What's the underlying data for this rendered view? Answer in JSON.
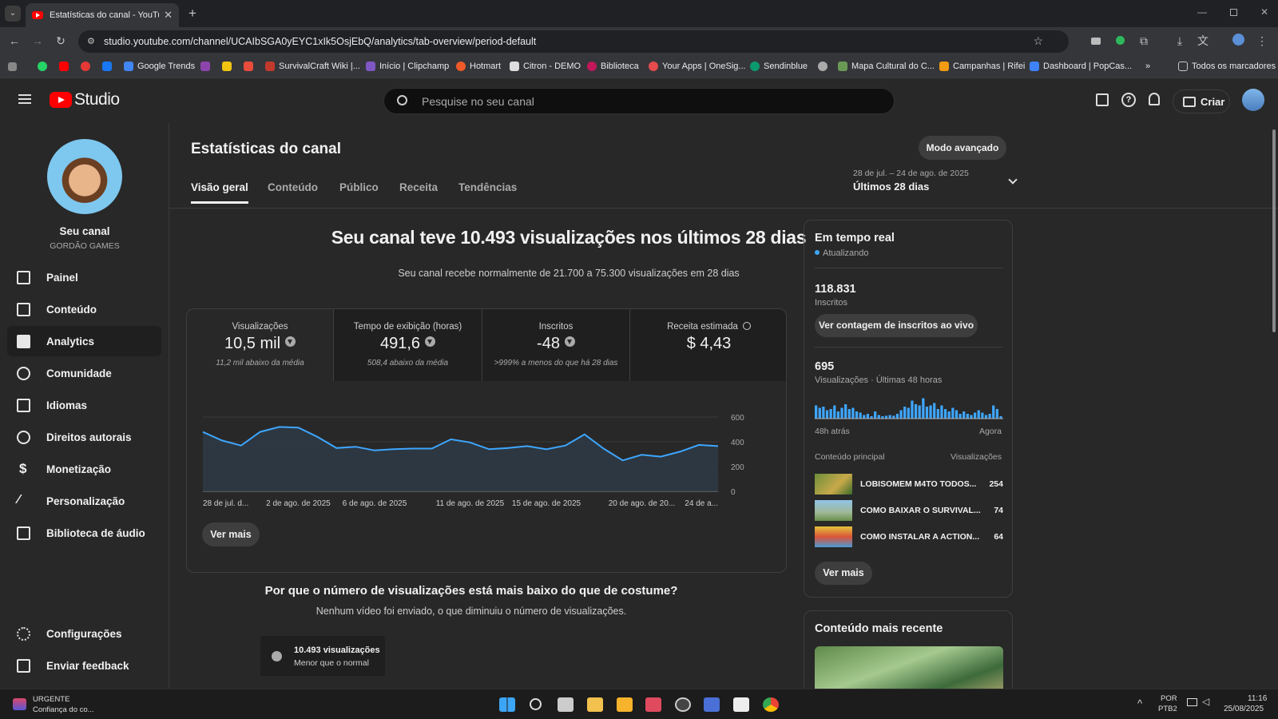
{
  "browser": {
    "tab_title": "Estatísticas do canal - YouTube",
    "url": "studio.youtube.com/channel/UCAIbSGA0yEYC1xIk5OsjEbQ/analytics/tab-overview/period-default",
    "bookmarks": [
      "Google Trends",
      "SurvivalCraft Wiki |...",
      "Início | Clipchamp",
      "Hotmart",
      "Citron - DEMO",
      "Biblioteca",
      "Your Apps | OneSig...",
      "Sendinblue",
      "Mapa Cultural do C...",
      "Campanhas | Rifei",
      "Dashboard | PopCas...",
      "Todos os marcadores"
    ]
  },
  "header": {
    "logo": "Studio",
    "search_placeholder": "Pesquise no seu canal",
    "create_label": "Criar"
  },
  "sidebar": {
    "channel_title": "Seu canal",
    "channel_name": "GORDÃO GAMES",
    "items": [
      {
        "label": "Painel",
        "icon": "dashboard-icon"
      },
      {
        "label": "Conteúdo",
        "icon": "content-icon"
      },
      {
        "label": "Analytics",
        "icon": "analytics-icon",
        "active": true
      },
      {
        "label": "Comunidade",
        "icon": "community-icon"
      },
      {
        "label": "Idiomas",
        "icon": "subtitles-icon"
      },
      {
        "label": "Direitos autorais",
        "icon": "copyright-icon"
      },
      {
        "label": "Monetização",
        "icon": "dollar-icon"
      },
      {
        "label": "Personalização",
        "icon": "magic-wand-icon"
      },
      {
        "label": "Biblioteca de áudio",
        "icon": "audio-library-icon"
      }
    ],
    "bottom": [
      {
        "label": "Configurações",
        "icon": "gear-icon"
      },
      {
        "label": "Enviar feedback",
        "icon": "feedback-icon"
      }
    ]
  },
  "page": {
    "title": "Estatísticas do canal",
    "advanced_mode": "Modo avançado",
    "date_range": "28 de jul. – 24 de ago. de 2025",
    "period": "Últimos 28 dias",
    "tabs": [
      "Visão geral",
      "Conteúdo",
      "Público",
      "Receita",
      "Tendências"
    ],
    "headline": "Seu canal teve 10.493 visualizações nos últimos 28 dias",
    "subheadline": "Seu canal recebe normalmente de 21.700 a 75.300 visualizações em 28 dias",
    "metrics": [
      {
        "label": "Visualizações",
        "value": "10,5 mil",
        "note": "11,2 mil abaixo da média"
      },
      {
        "label": "Tempo de exibição (horas)",
        "value": "491,6",
        "note": "508,4 abaixo da média"
      },
      {
        "label": "Inscritos",
        "value": "-48",
        "note": ">999% a menos do que há 28 dias"
      },
      {
        "label": "Receita estimada",
        "value": "$ 4,43",
        "note": ""
      }
    ],
    "see_more": "Ver mais",
    "why_title": "Por que o número de visualizações está mais baixo do que de costume?",
    "why_text": "Nenhum vídeo foi enviado, o que diminuiu o número de visualizações.",
    "why_card_title": "10.493 visualizações",
    "why_card_sub": "Menor que o normal"
  },
  "chart_data": {
    "type": "area",
    "x_tick_labels": [
      "28 de jul. d...",
      "2 de ago. de 2025",
      "6 de ago. de 2025",
      "11 de ago. de 2025",
      "15 de ago. de 2025",
      "20 de ago. de 20...",
      "24 de a..."
    ],
    "y_ticks": [
      "600",
      "400",
      "200",
      "0"
    ],
    "ylim": [
      0,
      600
    ],
    "values": [
      480,
      410,
      370,
      480,
      520,
      515,
      440,
      350,
      360,
      330,
      340,
      345,
      345,
      420,
      395,
      340,
      350,
      365,
      340,
      370,
      460,
      345,
      250,
      295,
      280,
      320,
      375,
      365
    ],
    "grid": true
  },
  "realtime": {
    "title": "Em tempo real",
    "status": "Atualizando",
    "subscribers": "118.831",
    "subscribers_label": "Inscritos",
    "live_button": "Ver contagem de inscritos ao vivo",
    "views": "695",
    "views_label": "Visualizações · Últimas 48 horas",
    "bars": [
      0.55,
      0.45,
      0.5,
      0.35,
      0.4,
      0.55,
      0.3,
      0.45,
      0.6,
      0.4,
      0.45,
      0.3,
      0.25,
      0.15,
      0.2,
      0.1,
      0.3,
      0.15,
      0.1,
      0.12,
      0.15,
      0.12,
      0.2,
      0.35,
      0.5,
      0.45,
      0.75,
      0.6,
      0.55,
      0.85,
      0.5,
      0.55,
      0.65,
      0.4,
      0.55,
      0.4,
      0.3,
      0.45,
      0.35,
      0.2,
      0.3,
      0.2,
      0.15,
      0.25,
      0.35,
      0.25,
      0.15,
      0.2,
      0.55,
      0.4,
      0.1
    ],
    "left_label": "48h atrás",
    "right_label": "Agora",
    "top_content_label": "Conteúdo principal",
    "top_views_label": "Visualizações",
    "videos": [
      {
        "title": "LOBISOMEM M4TO TODOS...",
        "views": "254"
      },
      {
        "title": "COMO BAIXAR O SURVIVAL...",
        "views": "74"
      },
      {
        "title": "COMO INSTALAR A ACTION...",
        "views": "64"
      }
    ],
    "see_more": "Ver mais"
  },
  "recent": {
    "title": "Conteúdo mais recente"
  },
  "taskbar": {
    "notif_title": "URGENTE",
    "notif_text": "Confiança do co...",
    "lang": "POR",
    "layout": "PTB2",
    "time": "11:16",
    "date": "25/08/2025"
  },
  "colors": {
    "accent": "#3ea6ff",
    "yt_red": "#ff0000",
    "bg": "#282828"
  }
}
